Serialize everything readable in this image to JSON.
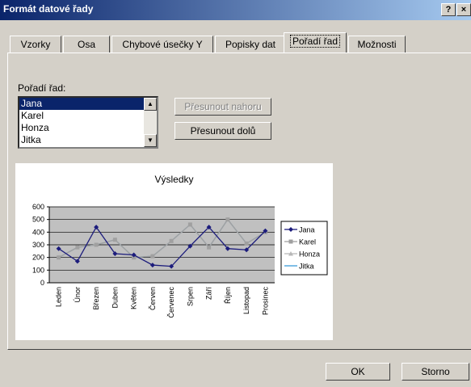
{
  "window": {
    "title": "Formát datové řady",
    "help_btn": "?",
    "close_btn": "×"
  },
  "tabs": [
    {
      "label": "Vzorky",
      "active": false
    },
    {
      "label": "Osa",
      "active": false
    },
    {
      "label": "Chybové úsečky Y",
      "active": false
    },
    {
      "label": "Popisky dat",
      "active": false
    },
    {
      "label": "Pořadí řad",
      "active": true
    },
    {
      "label": "Možnosti",
      "active": false
    }
  ],
  "order": {
    "label": "Pořadí řad:",
    "items": [
      "Jana",
      "Karel",
      "Honza",
      "Jitka"
    ],
    "selected": "Jana",
    "move_up": "Přesunout nahoru",
    "move_down": "Přesunout dolů"
  },
  "footer": {
    "ok": "OK",
    "cancel": "Storno"
  },
  "colors": {
    "jana": "#1c1c7c",
    "karel": "#a0a0a0",
    "honza": "#b8b8b8",
    "jitka": "#3a9ad8",
    "plot_bg": "#c0c0c0"
  },
  "chart_data": {
    "type": "line",
    "title": "Výsledky",
    "categories": [
      "Leden",
      "Únor",
      "Březen",
      "Duben",
      "Květen",
      "Červen",
      "Červenec",
      "Srpen",
      "Září",
      "Říjen",
      "Listopad",
      "Prosinec"
    ],
    "yticks": [
      "600",
      "500",
      "400",
      "300",
      "200",
      "100",
      "0"
    ],
    "ylim": [
      0,
      600
    ],
    "grid": true,
    "legend": "right",
    "series": [
      {
        "name": "Jana",
        "values": [
          270,
          170,
          440,
          230,
          220,
          140,
          130,
          290,
          440,
          270,
          260,
          410
        ],
        "marker": "diamond"
      },
      {
        "name": "Karel",
        "values": [
          200,
          280,
          300,
          340,
          200,
          210,
          330,
          460,
          280,
          500,
          310,
          400
        ],
        "marker": "square"
      },
      {
        "name": "Honza",
        "values": [
          200,
          280,
          300,
          340,
          200,
          210,
          330,
          460,
          280,
          500,
          310,
          400
        ],
        "marker": "triangle"
      },
      {
        "name": "Jitka",
        "values": [
          200,
          280,
          300,
          340,
          200,
          210,
          330,
          460,
          280,
          500,
          310,
          400
        ],
        "marker": "none"
      }
    ]
  }
}
